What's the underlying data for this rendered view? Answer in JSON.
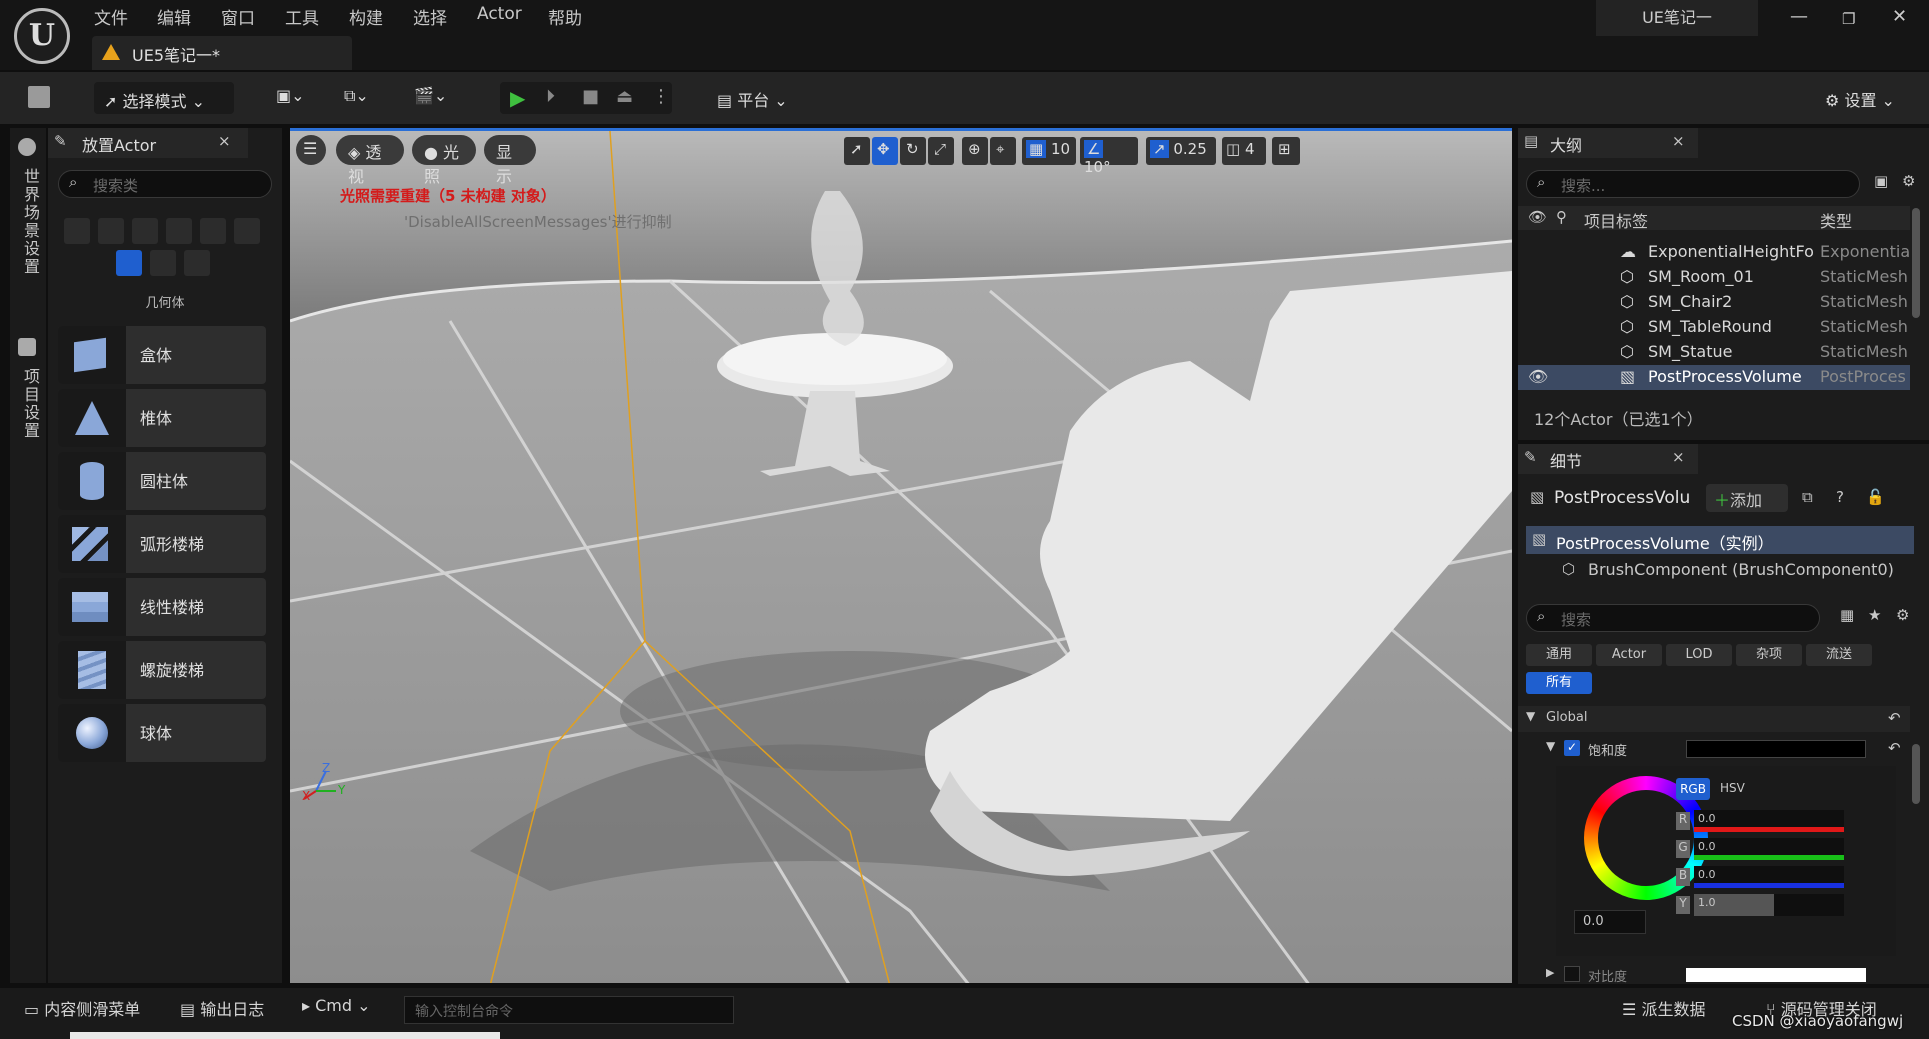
{
  "menu": [
    "文件",
    "编辑",
    "窗口",
    "工具",
    "构建",
    "选择",
    "Actor",
    "帮助"
  ],
  "doc_tab": "UE5笔记一*",
  "project_name": "UE笔记一",
  "toolbar": {
    "select_mode": "选择模式",
    "platform": "平台",
    "settings": "设置"
  },
  "vertical_tabs": [
    "世界场景设置",
    "项目设置"
  ],
  "place_panel": {
    "title": "放置Actor",
    "search_placeholder": "搜索类",
    "category_label": "几何体",
    "items": [
      "盒体",
      "椎体",
      "圆柱体",
      "弧形楼梯",
      "线性楼梯",
      "螺旋楼梯",
      "球体"
    ]
  },
  "viewport": {
    "perspective": "透视",
    "lighting": "光照",
    "show": "显示",
    "grid_snap": "10",
    "rot_snap": "10°",
    "scale_snap": "0.25",
    "cam_speed": "4",
    "warning": "光照需要重建（5 未构建 对象）",
    "warning_sub": "'DisableAllScreenMessages'进行抑制",
    "axis_z": "Z",
    "axis_x": "X",
    "axis_y": "Y"
  },
  "outliner": {
    "title": "大纲",
    "search_placeholder": "搜索...",
    "col_label": "项目标签",
    "col_type": "类型",
    "rows": [
      {
        "name": "ExponentialHeightFo",
        "type": "Exponentia"
      },
      {
        "name": "SM_Room_01",
        "type": "StaticMesh"
      },
      {
        "name": "SM_Chair2",
        "type": "StaticMesh"
      },
      {
        "name": "SM_TableRound",
        "type": "StaticMesh"
      },
      {
        "name": "SM_Statue",
        "type": "StaticMesh"
      },
      {
        "name": "PostProcessVolume",
        "type": "PostProces"
      }
    ],
    "summary": "12个Actor（已选1个）"
  },
  "details": {
    "title": "细节",
    "object_name": "PostProcessVolu",
    "add_label": "添加",
    "instance_row": "PostProcessVolume（实例）",
    "component_row": "BrushComponent (BrushComponent0)",
    "search_placeholder": "搜索",
    "tabs": [
      "通用",
      "Actor",
      "LOD",
      "杂项",
      "流送"
    ],
    "all_tab": "所有",
    "section": "Global",
    "property": "饱和度",
    "rgb": "RGB",
    "hsv": "HSV",
    "channels": [
      {
        "label": "R",
        "value": "0.0"
      },
      {
        "label": "G",
        "value": "0.0"
      },
      {
        "label": "B",
        "value": "0.0"
      },
      {
        "label": "Y",
        "value": "1.0"
      }
    ],
    "wheel_value": "0.0",
    "next_property": "对比度"
  },
  "bottom": {
    "content_drawer": "内容侧滑菜单",
    "output_log": "输出日志",
    "cmd": "Cmd",
    "console_placeholder": "输入控制台命令",
    "derived_data": "派生数据",
    "source_control": "源码管理关闭",
    "watermark": "CSDN @xiaoyaofangwj"
  }
}
